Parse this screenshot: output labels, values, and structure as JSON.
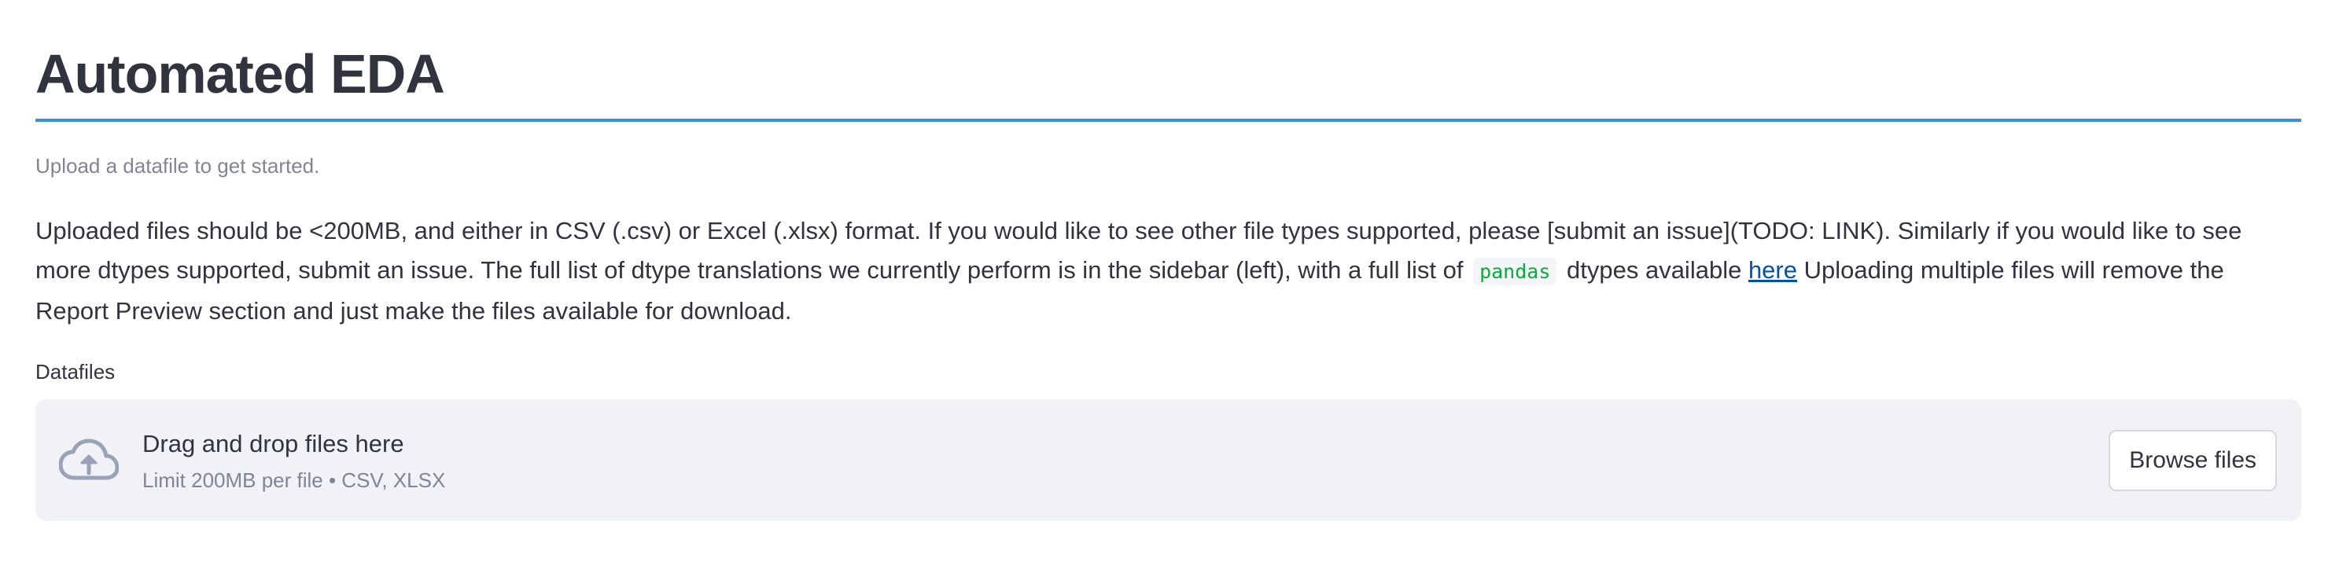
{
  "page": {
    "title": "Automated EDA",
    "caption": "Upload a datafile to get started.",
    "description": {
      "part1": "Uploaded files should be <200MB, and either in CSV (.csv) or Excel (.xlsx) format. If you would like to see other file types supported, please [submit an issue](TODO: LINK). Similarly if you would like to see more dtypes supported, submit an issue. The full list of dtype translations we currently perform is in the sidebar (left), with a full list of ",
      "code": "pandas",
      "part2": " dtypes available ",
      "link_text": "here",
      "part3": " Uploading multiple files will remove the Report Preview section and just make the files available for download."
    }
  },
  "uploader": {
    "label": "Datafiles",
    "icon": "cloud-upload-icon",
    "drop_text": "Drag and drop files here",
    "limit_text": "Limit 200MB per file • CSV, XLSX",
    "browse_label": "Browse files"
  },
  "colors": {
    "accent_rule": "#3b8fe0",
    "text": "#31333f",
    "muted": "#808495",
    "link": "#0054a3",
    "code": "#09ab3b",
    "dropzone_bg": "#f0f2f6"
  }
}
